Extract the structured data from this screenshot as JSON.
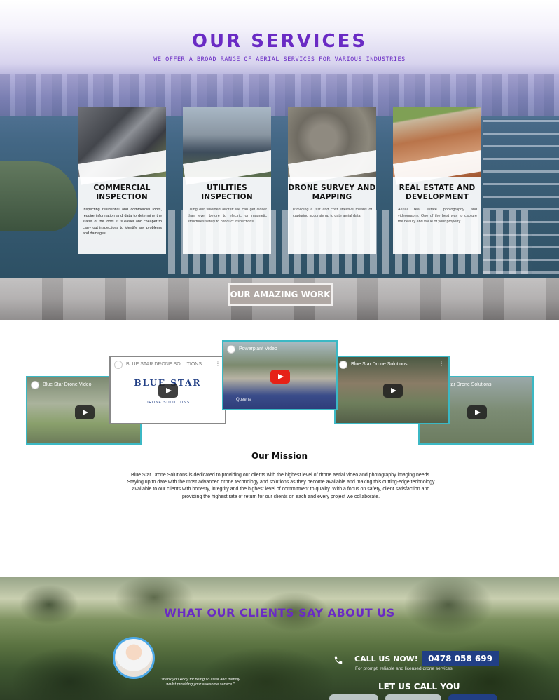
{
  "services": {
    "title": "OUR SERVICES",
    "subtitle": "WE OFFER A BROAD RANGE OF AERIAL SERVICES FOR VARIOUS INDUSTRIES",
    "cards": [
      {
        "title": "COMMERCIAL INSPECTION",
        "description": "Inspecting residential and commercial roofs, require information and data to determine the status of the roofs. It is easier and cheaper to carry out inspections to identify any problems and damages."
      },
      {
        "title": "UTILITIES INSPECTION",
        "description": "Using our shielded aircraft we can get closer than ever before to electric or magnetic structures safely to conduct inspections."
      },
      {
        "title": "DRONE SURVEY AND MAPPING",
        "description": "Providing a fast and cost effective means of capturing accurate up to date aerial data."
      },
      {
        "title": "REAL ESTATE AND DEVELOPMENT",
        "description": "Aerial real estate photography and videography. One of the best way to capture the beauty and value of your property."
      }
    ],
    "work_button": "OUR AMAZING WORK"
  },
  "videos": [
    {
      "title": "Blue Star Drone Video"
    },
    {
      "title": "BLUE STAR DRONE SOLUTIONS",
      "logo": "BLUE STAR",
      "logo_sub": "DRONE SOLUTIONS"
    },
    {
      "title": "Powerplant Video",
      "label": "Queens"
    },
    {
      "title": "Blue Star Drone Solutions"
    },
    {
      "title": "Blue Star Drone Solutions"
    }
  ],
  "mission": {
    "title": "Our Mission",
    "text": "Blue Star Drone Solutions is dedicated to providing our clients with the highest level of drone aerial video and photography imaging needs. Staying up to date with the most advanced drone technology and solutions as they become available and making this cutting-edge technology available to our clients with honesty, integrity and the highest level of commitment to quality. With a focus on safety, client satisfaction and providing the highest rate of return for our clients on each and every project we collaborate."
  },
  "clients": {
    "title": "WHAT OUR CLIENTS SAY ABOUT US",
    "quote": "\"thank you Andy for being so clear and friendly whilst providing your awesome service.\"",
    "call_label": "CALL US NOW!",
    "phone": "0478 058 699",
    "call_sub": "For prompt, reliable and licensed drone services",
    "let_us_call": "LET US CALL YOU"
  },
  "colors": {
    "brand_purple": "#6a2bc4",
    "brand_blue": "#213f85",
    "video_border": "#3bb8c4"
  }
}
